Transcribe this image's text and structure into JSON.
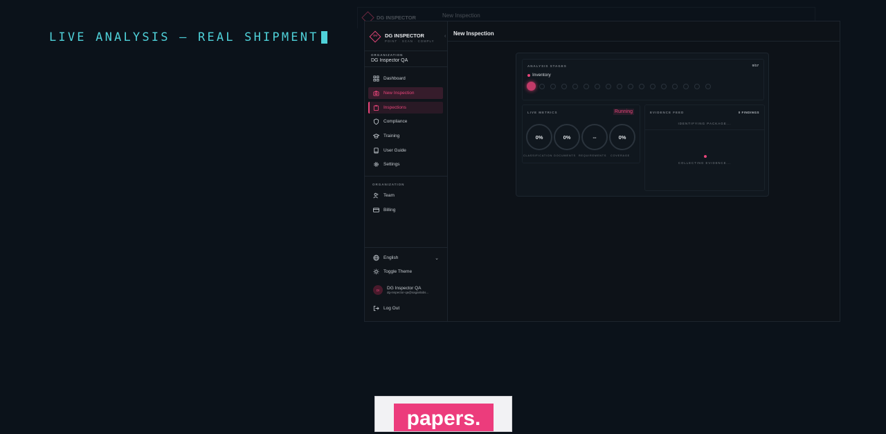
{
  "headline": {
    "text": "LIVE ANALYSIS — REAL SHIPMENT"
  },
  "ghost": {
    "title": "DG INSPECTOR",
    "tagline": "POINT · SCAN · COMPLY",
    "page": "New Inspection"
  },
  "app": {
    "brand": {
      "name": "DG INSPECTOR",
      "tagline": "POINT · SCAN · COMPLY",
      "logo_text": "DG"
    },
    "organization": {
      "label": "ORGANIZATION",
      "name": "DG Inspector QA"
    },
    "nav": [
      {
        "label": "Dashboard",
        "icon": "grid-icon"
      },
      {
        "label": "New Inspection",
        "icon": "camera-icon"
      },
      {
        "label": "Inspections",
        "icon": "clipboard-icon"
      },
      {
        "label": "Compliance",
        "icon": "shield-icon"
      },
      {
        "label": "Training",
        "icon": "graduation-cap-icon"
      },
      {
        "label": "User Guide",
        "icon": "book-icon"
      },
      {
        "label": "Settings",
        "icon": "gear-icon"
      }
    ],
    "org_section": {
      "label": "ORGANIZATION",
      "items": [
        {
          "label": "Team",
          "icon": "users-icon"
        },
        {
          "label": "Billing",
          "icon": "credit-card-icon"
        }
      ]
    },
    "footer": {
      "language": "English",
      "toggle_theme": "Toggle Theme",
      "user_initials": "DI",
      "user_name": "DG Inspector QA",
      "user_email": "dg-inspector-qa@saganlabs...",
      "logout": "Log Out"
    },
    "page_title": "New Inspection",
    "analysis": {
      "stages_label": "ANALYSIS STAGES",
      "stages_count": "0/17",
      "current_stage": "Inventory",
      "metrics_label": "LIVE METRICS",
      "status": "Running",
      "metrics": [
        {
          "value": "0%",
          "label": "CLASSIFICATION"
        },
        {
          "value": "0%",
          "label": "DOCUMENTS"
        },
        {
          "value": "--",
          "label": "REQUIREMENTS"
        },
        {
          "value": "0%",
          "label": "COVERAGE"
        }
      ],
      "evidence_label": "EVIDENCE FEED",
      "findings": "0 FINDINGS",
      "evidence_status": "IDENTIFYING PACKAGE...",
      "collecting": "COLLECTING EVIDENCE..."
    }
  },
  "watermark": {
    "text": "papers."
  },
  "colors": {
    "accent": "#e8457a",
    "headline": "#4fd1d9",
    "background": "#0b121a"
  }
}
